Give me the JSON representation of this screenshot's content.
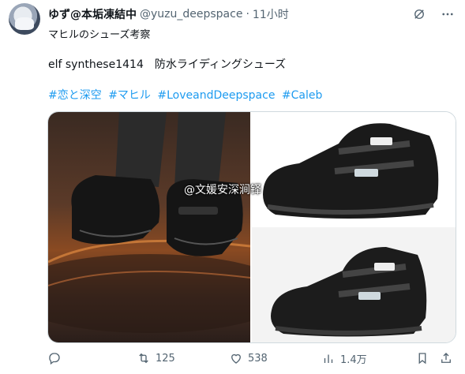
{
  "tweet": {
    "display_name": "ゆず@本垢凍結中",
    "handle": "@yuzu_deepspace",
    "separator": "·",
    "time": "11小时",
    "subtitle": "マヒルのシューズ考察",
    "body": "elf synthese1414　防水ライディングシューズ",
    "hashtags": [
      "#恋と深空",
      "#マヒル",
      "#LoveandDeepspace",
      "#Caleb"
    ]
  },
  "media": {
    "watermark": "@文媛安深涧铎"
  },
  "actions": {
    "reply": "",
    "retweet_count": "125",
    "like_count": "538",
    "views_count": "1.4万"
  }
}
